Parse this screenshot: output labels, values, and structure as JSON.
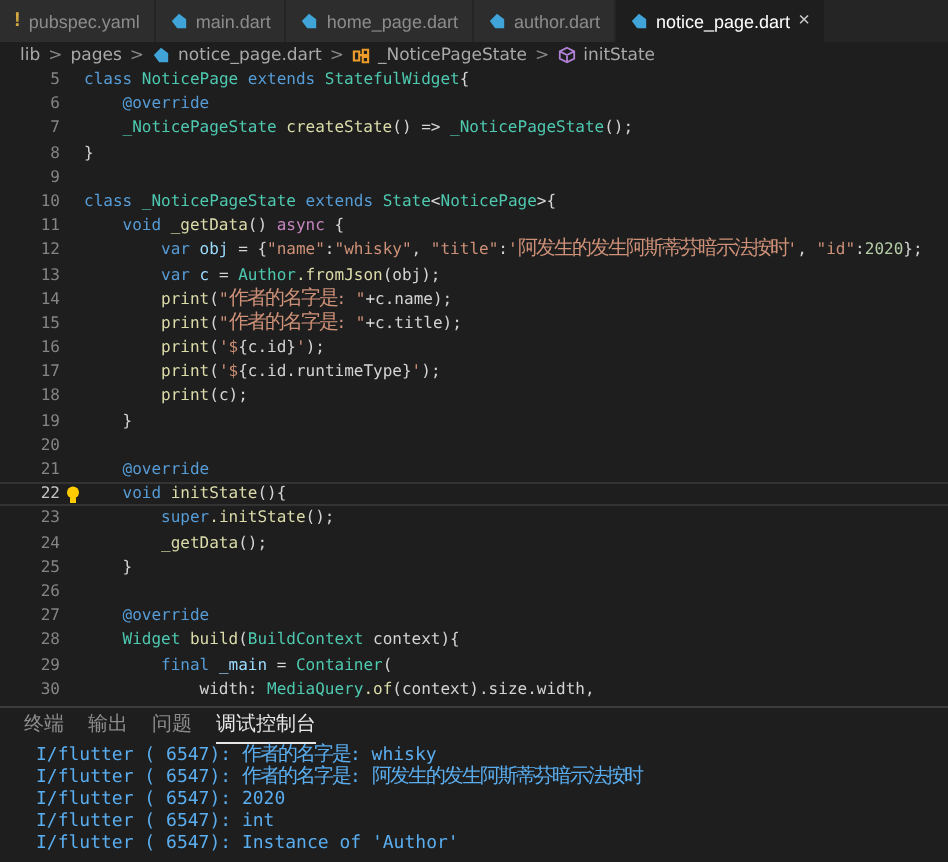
{
  "tabs": [
    {
      "label": "pubspec.yaml",
      "kind": "yaml",
      "icon": "!",
      "selected": false
    },
    {
      "label": "main.dart",
      "kind": "dart",
      "selected": false
    },
    {
      "label": "home_page.dart",
      "kind": "dart",
      "selected": false
    },
    {
      "label": "author.dart",
      "kind": "dart",
      "selected": false
    },
    {
      "label": "notice_page.dart",
      "kind": "dart",
      "selected": true,
      "close": "×"
    }
  ],
  "breadcrumb": [
    {
      "label": "lib",
      "kind": "folder"
    },
    {
      "label": "pages",
      "kind": "folder"
    },
    {
      "label": "notice_page.dart",
      "kind": "dart"
    },
    {
      "label": "_NoticePageState",
      "kind": "class"
    },
    {
      "label": "initState",
      "kind": "method"
    }
  ],
  "breadcrumb_separator": ">",
  "code_lines": [
    {
      "number": "5",
      "current": false,
      "tokens": [
        {
          "kind": "kw",
          "text": "class"
        },
        {
          "kind": "type",
          "text": " NoticePage"
        },
        {
          "kind": "kw",
          "text": " extends"
        },
        {
          "kind": "type",
          "text": " StatefulWidget"
        },
        {
          "kind": "plain",
          "text": "{"
        }
      ]
    },
    {
      "number": "6",
      "current": false,
      "tokens": [
        {
          "kind": "kw",
          "text": "    @override"
        }
      ]
    },
    {
      "number": "7",
      "current": false,
      "tokens": [
        {
          "kind": "type",
          "text": "    _NoticePageState"
        },
        {
          "kind": "fn",
          "text": " createState"
        },
        {
          "kind": "plain",
          "text": "() =>"
        },
        {
          "kind": "type",
          "text": " _NoticePageState"
        },
        {
          "kind": "plain",
          "text": "();"
        }
      ]
    },
    {
      "number": "8",
      "current": false,
      "tokens": [
        {
          "kind": "plain",
          "text": "}"
        }
      ]
    },
    {
      "number": "9",
      "current": false
    },
    {
      "number": "10",
      "current": false,
      "tokens": [
        {
          "kind": "kw",
          "text": "class"
        },
        {
          "kind": "type",
          "text": " _NoticePageState"
        },
        {
          "kind": "kw",
          "text": " extends"
        },
        {
          "kind": "type",
          "text": " State"
        },
        {
          "kind": "plain",
          "text": "<"
        },
        {
          "kind": "type",
          "text": "NoticePage"
        },
        {
          "kind": "plain",
          "text": ">{"
        }
      ]
    },
    {
      "number": "11",
      "current": false,
      "tokens": [
        {
          "kind": "kw",
          "text": "    void"
        },
        {
          "kind": "fn",
          "text": " _getData"
        },
        {
          "kind": "plain",
          "text": "()"
        },
        {
          "kind": "ctl",
          "text": " async"
        },
        {
          "kind": "plain",
          "text": " {"
        }
      ]
    },
    {
      "number": "12",
      "current": false,
      "tokens": [
        {
          "kind": "kw",
          "text": "        var"
        },
        {
          "kind": "var",
          "text": " obj"
        },
        {
          "kind": "plain",
          "text": " = {"
        },
        {
          "kind": "str",
          "text": "\"name\""
        },
        {
          "kind": "plain",
          "text": ":"
        },
        {
          "kind": "str",
          "text": "\"whisky\""
        },
        {
          "kind": "plain",
          "text": ","
        },
        {
          "kind": "str",
          "text": " \"title\""
        },
        {
          "kind": "plain",
          "text": ":"
        },
        {
          "kind": "str",
          "text": "'阿发生的发生阿斯蒂芬暗示法按时'"
        },
        {
          "kind": "plain",
          "text": ","
        },
        {
          "kind": "str",
          "text": " \"id\""
        },
        {
          "kind": "plain",
          "text": ":"
        },
        {
          "kind": "num",
          "text": "2020"
        },
        {
          "kind": "plain",
          "text": "};"
        }
      ]
    },
    {
      "number": "13",
      "current": false,
      "tokens": [
        {
          "kind": "kw",
          "text": "        var"
        },
        {
          "kind": "var",
          "text": " c"
        },
        {
          "kind": "plain",
          "text": " ="
        },
        {
          "kind": "type",
          "text": " Author"
        },
        {
          "kind": "fn",
          "text": ".fromJson"
        },
        {
          "kind": "plain",
          "text": "(obj);"
        }
      ]
    },
    {
      "number": "14",
      "current": false,
      "tokens": [
        {
          "kind": "fn",
          "text": "        print"
        },
        {
          "kind": "plain",
          "text": "("
        },
        {
          "kind": "str",
          "text": "\"作者的名字是: \""
        },
        {
          "kind": "plain",
          "text": "+c.name);"
        }
      ]
    },
    {
      "number": "15",
      "current": false,
      "tokens": [
        {
          "kind": "fn",
          "text": "        print"
        },
        {
          "kind": "plain",
          "text": "("
        },
        {
          "kind": "str",
          "text": "\"作者的名字是: \""
        },
        {
          "kind": "plain",
          "text": "+c.title);"
        }
      ]
    },
    {
      "number": "16",
      "current": false,
      "tokens": [
        {
          "kind": "fn",
          "text": "        print"
        },
        {
          "kind": "plain",
          "text": "("
        },
        {
          "kind": "str",
          "text": "'$"
        },
        {
          "kind": "plain",
          "text": "{c.id}"
        },
        {
          "kind": "str",
          "text": "'"
        },
        {
          "kind": "plain",
          "text": ");"
        }
      ]
    },
    {
      "number": "17",
      "current": false,
      "tokens": [
        {
          "kind": "fn",
          "text": "        print"
        },
        {
          "kind": "plain",
          "text": "("
        },
        {
          "kind": "str",
          "text": "'$"
        },
        {
          "kind": "plain",
          "text": "{c.id.runtimeType}"
        },
        {
          "kind": "str",
          "text": "'"
        },
        {
          "kind": "plain",
          "text": ");"
        }
      ]
    },
    {
      "number": "18",
      "current": false,
      "tokens": [
        {
          "kind": "fn",
          "text": "        print"
        },
        {
          "kind": "plain",
          "text": "(c);"
        }
      ]
    },
    {
      "number": "19",
      "current": false,
      "tokens": [
        {
          "kind": "plain",
          "text": "    }"
        }
      ]
    },
    {
      "number": "20",
      "current": false
    },
    {
      "number": "21",
      "current": false,
      "tokens": [
        {
          "kind": "kw",
          "text": "    @override"
        }
      ]
    },
    {
      "number": "22",
      "current": true,
      "tokens": [
        {
          "kind": "kw",
          "text": "    void"
        },
        {
          "kind": "fn",
          "text": " initState"
        },
        {
          "kind": "plain",
          "text": "(){"
        }
      ]
    },
    {
      "number": "23",
      "current": false,
      "tokens": [
        {
          "kind": "kw",
          "text": "        super"
        },
        {
          "kind": "fn",
          "text": ".initState"
        },
        {
          "kind": "plain",
          "text": "();"
        }
      ]
    },
    {
      "number": "24",
      "current": false,
      "tokens": [
        {
          "kind": "fn",
          "text": "        _getData"
        },
        {
          "kind": "plain",
          "text": "();"
        }
      ]
    },
    {
      "number": "25",
      "current": false,
      "tokens": [
        {
          "kind": "plain",
          "text": "    }"
        }
      ]
    },
    {
      "number": "26",
      "current": false
    },
    {
      "number": "27",
      "current": false,
      "tokens": [
        {
          "kind": "kw",
          "text": "    @override"
        }
      ]
    },
    {
      "number": "28",
      "current": false,
      "tokens": [
        {
          "kind": "type",
          "text": "    Widget"
        },
        {
          "kind": "fn",
          "text": " build"
        },
        {
          "kind": "plain",
          "text": "("
        },
        {
          "kind": "type",
          "text": "BuildContext"
        },
        {
          "kind": "plain",
          "text": " context){"
        }
      ]
    },
    {
      "number": "29",
      "current": false,
      "tokens": [
        {
          "kind": "kw",
          "text": "        final"
        },
        {
          "kind": "var",
          "text": " _main"
        },
        {
          "kind": "plain",
          "text": " ="
        },
        {
          "kind": "type",
          "text": " Container"
        },
        {
          "kind": "plain",
          "text": "("
        }
      ]
    },
    {
      "number": "30",
      "current": false,
      "tokens": [
        {
          "kind": "plain",
          "text": "            width:"
        },
        {
          "kind": "type",
          "text": " MediaQuery"
        },
        {
          "kind": "fn",
          "text": ".of"
        },
        {
          "kind": "plain",
          "text": "(context).size.width,"
        }
      ]
    }
  ],
  "panel_tabs": [
    {
      "label": "终端",
      "selected": false
    },
    {
      "label": "输出",
      "selected": false
    },
    {
      "label": "问题",
      "selected": false
    },
    {
      "label": "调试控制台",
      "selected": true
    }
  ],
  "console_lines": [
    "I/flutter ( 6547): 作者的名字是: whisky",
    "I/flutter ( 6547): 作者的名字是: 阿发生的发生阿斯蒂芬暗示法按时",
    "I/flutter ( 6547): 2020",
    "I/flutter ( 6547): int",
    "I/flutter ( 6547): Instance of 'Author'"
  ]
}
